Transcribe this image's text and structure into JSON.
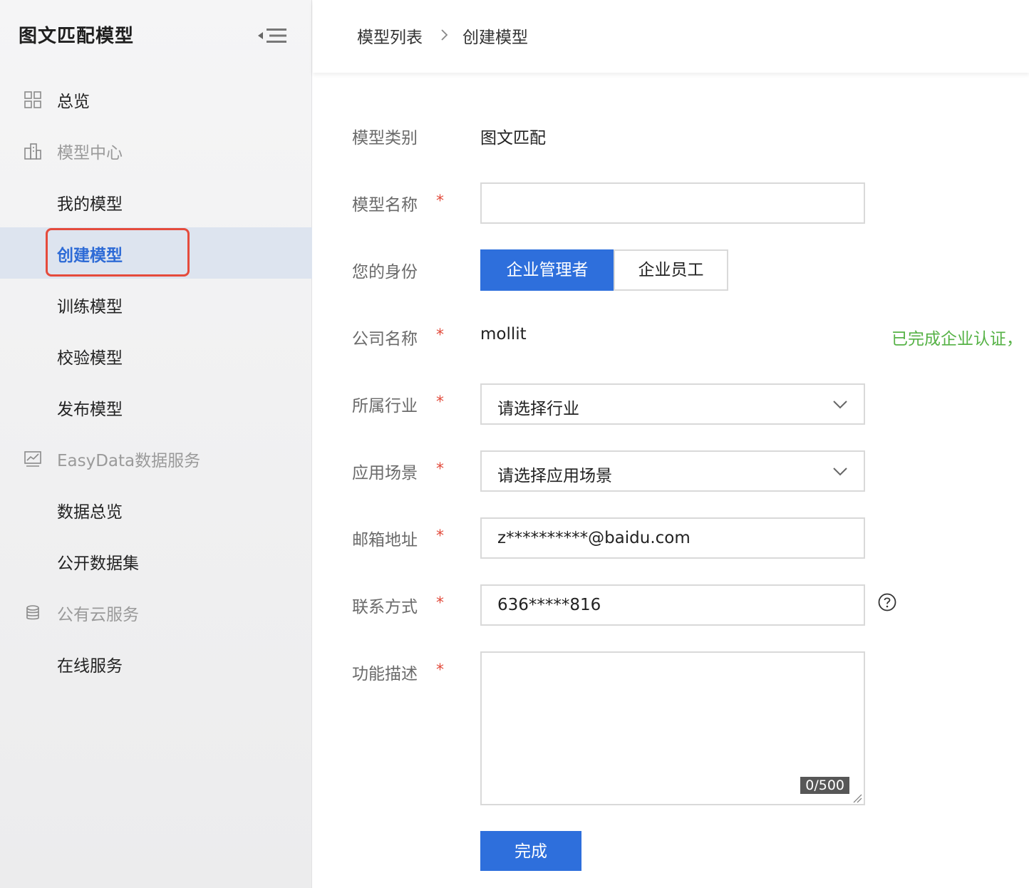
{
  "app": {
    "title": "图文匹配模型"
  },
  "sidebar": {
    "items": [
      {
        "label": "总览",
        "icon": "grid-icon"
      },
      {
        "label": "模型中心",
        "icon": "building-icon"
      },
      {
        "label": "我的模型"
      },
      {
        "label": "创建模型"
      },
      {
        "label": "训练模型"
      },
      {
        "label": "校验模型"
      },
      {
        "label": "发布模型"
      },
      {
        "label": "EasyData数据服务",
        "icon": "chart-icon"
      },
      {
        "label": "数据总览"
      },
      {
        "label": "公开数据集"
      },
      {
        "label": "公有云服务",
        "icon": "database-icon"
      },
      {
        "label": "在线服务"
      }
    ],
    "active_index": 3
  },
  "breadcrumb": {
    "parent": "模型列表",
    "current": "创建模型"
  },
  "form": {
    "category_label": "模型类别",
    "category_value": "图文匹配",
    "name_label": "模型名称",
    "name_value": "",
    "identity_label": "您的身份",
    "identity_options": [
      "企业管理者",
      "企业员工"
    ],
    "identity_selected": "企业管理者",
    "company_label": "公司名称",
    "company_value": "mollit",
    "company_status": "已完成企业认证，",
    "industry_label": "所属行业",
    "industry_placeholder": "请选择行业",
    "scenario_label": "应用场景",
    "scenario_placeholder": "请选择应用场景",
    "email_label": "邮箱地址",
    "email_value": "z**********@baidu.com",
    "phone_label": "联系方式",
    "phone_value": "636*****816",
    "desc_label": "功能描述",
    "desc_value": "",
    "desc_counter": "0/500",
    "required_mark": "*",
    "submit_label": "完成"
  },
  "colors": {
    "primary": "#2e6fdc",
    "active_bg": "#dde4ef",
    "highlight_border": "#e54b3c",
    "required": "#e24a3b",
    "success": "#56b246"
  }
}
